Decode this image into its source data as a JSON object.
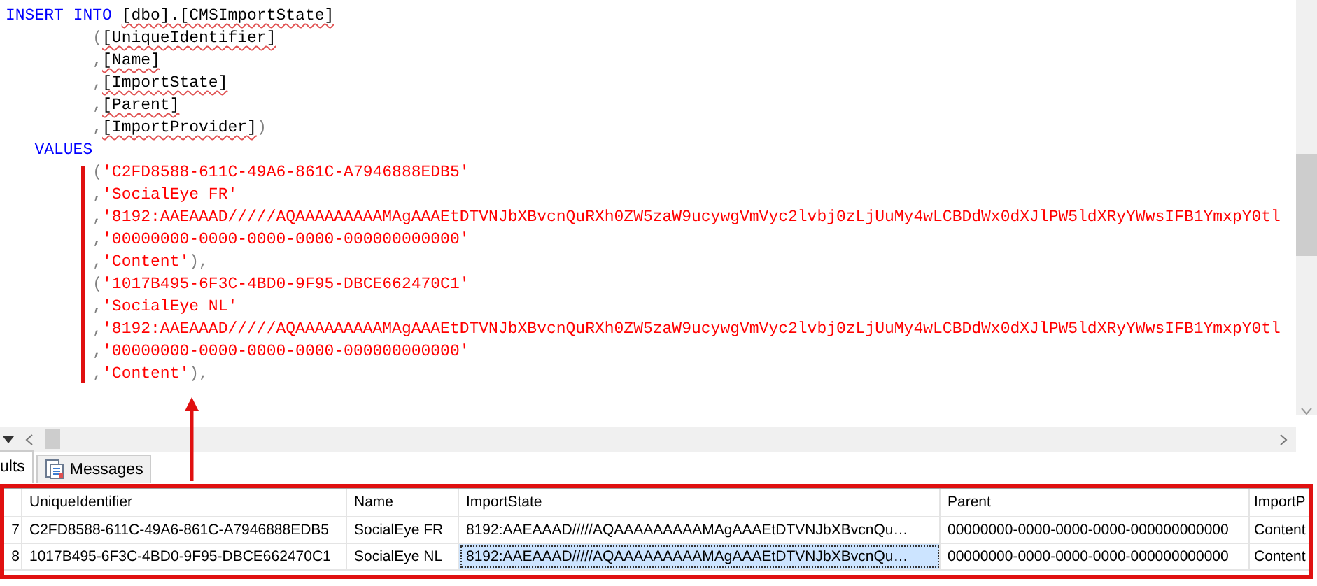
{
  "editor": {
    "lines": [
      {
        "kind": "statement",
        "tokens": [
          {
            "text": "INSERT ",
            "kind": "keyword"
          },
          {
            "text": "INTO ",
            "kind": "keyword"
          },
          {
            "text": "[dbo].[CMSImportState]",
            "kind": "ident"
          }
        ]
      },
      {
        "kind": "column",
        "tokens": [
          {
            "text": "(",
            "kind": "punct"
          },
          {
            "text": "[UniqueIdentifier]",
            "kind": "ident"
          }
        ]
      },
      {
        "kind": "column",
        "tokens": [
          {
            "text": ",",
            "kind": "punct"
          },
          {
            "text": "[Name]",
            "kind": "ident"
          }
        ]
      },
      {
        "kind": "column",
        "tokens": [
          {
            "text": ",",
            "kind": "punct"
          },
          {
            "text": "[ImportState]",
            "kind": "ident"
          }
        ]
      },
      {
        "kind": "column",
        "tokens": [
          {
            "text": ",",
            "kind": "punct"
          },
          {
            "text": "[Parent]",
            "kind": "ident"
          }
        ]
      },
      {
        "kind": "column",
        "tokens": [
          {
            "text": ",",
            "kind": "punct"
          },
          {
            "text": "[ImportProvider]",
            "kind": "ident"
          },
          {
            "text": ")",
            "kind": "punct"
          }
        ]
      },
      {
        "kind": "values",
        "tokens": [
          {
            "text": "VALUES",
            "kind": "keyword"
          }
        ]
      },
      {
        "kind": "row",
        "tokens": [
          {
            "text": "(",
            "kind": "punct"
          },
          {
            "text": "'C2FD8588-611C-49A6-861C-A7946888EDB5'",
            "kind": "string"
          }
        ]
      },
      {
        "kind": "row",
        "tokens": [
          {
            "text": ",",
            "kind": "punct"
          },
          {
            "text": "'SocialEye FR'",
            "kind": "string"
          }
        ]
      },
      {
        "kind": "row",
        "tokens": [
          {
            "text": ",",
            "kind": "punct"
          },
          {
            "text": "'8192:AAEAAAD/////AQAAAAAAAAAMAgAAAEtDTVNJbXBvcnQuRXh0ZW5zaW9ucywgVmVyc2lvbj0zLjUuMy4wLCBDdWx0dXJlPW5ldXRyYWwsIFB1YmxpY0tl",
            "kind": "string"
          }
        ]
      },
      {
        "kind": "row",
        "tokens": [
          {
            "text": ",",
            "kind": "punct"
          },
          {
            "text": "'00000000-0000-0000-0000-000000000000'",
            "kind": "string"
          }
        ]
      },
      {
        "kind": "row",
        "tokens": [
          {
            "text": ",",
            "kind": "punct"
          },
          {
            "text": "'Content'",
            "kind": "string"
          },
          {
            "text": "),",
            "kind": "punct"
          }
        ]
      },
      {
        "kind": "row",
        "tokens": [
          {
            "text": "(",
            "kind": "punct"
          },
          {
            "text": "'1017B495-6F3C-4BD0-9F95-DBCE662470C1'",
            "kind": "string"
          }
        ]
      },
      {
        "kind": "row",
        "tokens": [
          {
            "text": ",",
            "kind": "punct"
          },
          {
            "text": "'SocialEye NL'",
            "kind": "string"
          }
        ]
      },
      {
        "kind": "row",
        "tokens": [
          {
            "text": ",",
            "kind": "punct"
          },
          {
            "text": "'8192:AAEAAAD/////AQAAAAAAAAAMAgAAAEtDTVNJbXBvcnQuRXh0ZW5zaW9ucywgVmVyc2lvbj0zLjUuMy4wLCBDdWx0dXJlPW5ldXRyYWwsIFB1YmxpY0tl",
            "kind": "string"
          }
        ]
      },
      {
        "kind": "row",
        "tokens": [
          {
            "text": ",",
            "kind": "punct"
          },
          {
            "text": "'00000000-0000-0000-0000-000000000000'",
            "kind": "string"
          }
        ]
      },
      {
        "kind": "row",
        "tokens": [
          {
            "text": ",",
            "kind": "punct"
          },
          {
            "text": "'Content'",
            "kind": "string"
          },
          {
            "text": "),",
            "kind": "punct"
          }
        ]
      }
    ]
  },
  "results_tabs": [
    {
      "label": "ults",
      "selected": true,
      "kind": "grid"
    },
    {
      "label": "Messages",
      "selected": false,
      "kind": "messages"
    }
  ],
  "grid": {
    "columns": [
      "UniqueIdentifier",
      "Name",
      "ImportState",
      "Parent",
      "ImportP"
    ],
    "rows": [
      {
        "row_number": "7",
        "cells": [
          {
            "text": "C2FD8588-611C-49A6-861C-A7946888EDB5",
            "selected": false
          },
          {
            "text": "SocialEye FR",
            "selected": false
          },
          {
            "text": "8192:AAEAAAD/////AQAAAAAAAAAMAgAAAEtDTVNJbXBvcnQu…",
            "selected": false
          },
          {
            "text": "00000000-0000-0000-0000-000000000000",
            "selected": false
          },
          {
            "text": "Content",
            "selected": false
          }
        ]
      },
      {
        "row_number": "8",
        "cells": [
          {
            "text": "1017B495-6F3C-4BD0-9F95-DBCE662470C1",
            "selected": false
          },
          {
            "text": "SocialEye NL",
            "selected": false
          },
          {
            "text": "8192:AAEAAAD/////AQAAAAAAAAAMAgAAAEtDTVNJbXBvcnQu…",
            "selected": true
          },
          {
            "text": "00000000-0000-0000-0000-000000000000",
            "selected": false
          },
          {
            "text": "Content",
            "selected": false
          }
        ]
      }
    ]
  }
}
